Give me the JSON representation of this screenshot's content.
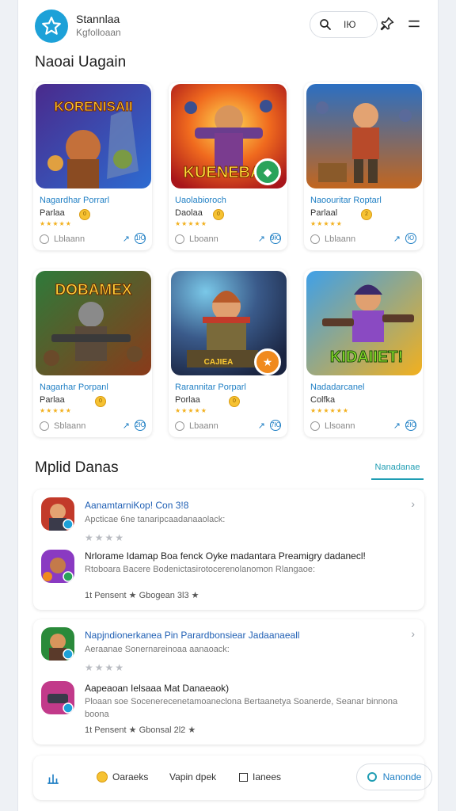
{
  "header": {
    "brand_title": "Stannlaa",
    "brand_sub": "Kgfolloaan",
    "lang_label": "IЮ",
    "icons": [
      "star-logo-icon",
      "search-icon",
      "pin-icon",
      "menu-icon"
    ]
  },
  "section1": {
    "title": "Naoai Uagain"
  },
  "cards": [
    {
      "name": "Nagardhar Porrarl",
      "sub": "Parlaa",
      "coin": "0",
      "meta": "Lblaann",
      "share": "1Ю"
    },
    {
      "name": "Uaolabioroch",
      "sub": "Daolaa",
      "coin": "0",
      "meta": "Lboann",
      "share": "9Ю"
    },
    {
      "name": "Naoouritar Roptarl",
      "sub": "Parlaal",
      "coin": "2",
      "meta": "Lblaann",
      "share": "Ю"
    },
    {
      "name": "Nagarhar Porpanl",
      "sub": "Parlaa",
      "coin": "0",
      "meta": "Sblaann",
      "share": "2Ю"
    },
    {
      "name": "Rarannitar Porparl",
      "sub": "Porlaa",
      "coin": "0",
      "meta": "Lbaann",
      "share": "7Ю"
    },
    {
      "name": "Nadadarcanel",
      "sub": "Colfka",
      "coin": "",
      "meta": "Llsoann",
      "share": "2Ю"
    }
  ],
  "thumb_titles": [
    "KORENISAII",
    "KUENEBA",
    "",
    "DOBAMEX",
    "CAJIEA",
    "KIDAIIET!"
  ],
  "section2": {
    "title": "Mplid Danas",
    "link": "Nanadanae"
  },
  "groups": [
    {
      "rows": [
        {
          "title": "AanamtarniKop! Con 3!8",
          "desc": "Apcticae 6ne tanaripcaadanaaolack:",
          "stars": "★★★★"
        },
        {
          "title": "Nrlorame Idamap Boa fenck Oyke madantara Preamigry dadanecl!",
          "desc": "Rtoboara Bacere Bodenictasirotocerenolanomon Rlangaoe:",
          "meta": "1t Pensent ★ Gbogean 3l3 ★"
        }
      ]
    },
    {
      "rows": [
        {
          "title": "Napjndionerkanea Pin Parardbonsiear Jadaanaeall",
          "desc": "Aeraanae Sonernareinoaa aanaoack:",
          "stars": "★★★★"
        },
        {
          "title": "Aapeaoan Ielsaaa Mat Danaeaok)",
          "desc": "Ploaan soe Socenerecenetamoaneclona Bertaanetya Soanerde, Seanar binnona boona",
          "meta": "1t Pensent ★ Gbonsal 2l2 ★"
        }
      ]
    }
  ],
  "bottom_nav": {
    "item1": "Oaraeks",
    "item2": "Vapin dpek",
    "item3": "Ianees",
    "button": "Nanonde"
  },
  "colors": {
    "accent": "#1da1d8",
    "link": "#1f7fc4",
    "teal": "#1f9db3",
    "star": "#f2b01e"
  }
}
